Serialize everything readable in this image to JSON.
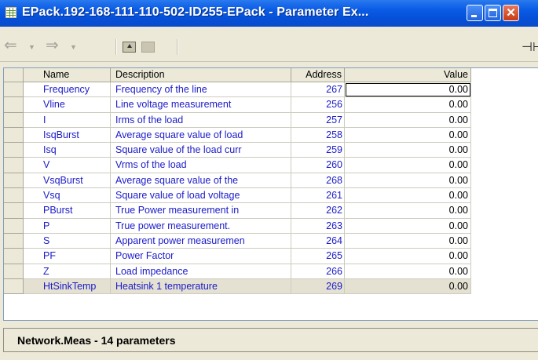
{
  "window": {
    "title": "EPack.192-168-111-110-502-ID255-EPack - Parameter Ex...",
    "app_icon": "table-icon",
    "close_glyph": "✕"
  },
  "toolbar": {
    "back_glyph": "⇐",
    "forward_glyph": "⇒",
    "dropdown_glyph": "▼",
    "pin_glyph": "⊣⊢"
  },
  "table": {
    "columns": [
      "Name",
      "Description",
      "Address",
      "Value"
    ],
    "rows": [
      {
        "name": "Frequency",
        "description": "Frequency of the line",
        "address": "267",
        "value": "0.00"
      },
      {
        "name": "Vline",
        "description": "Line voltage measurement",
        "address": "256",
        "value": "0.00"
      },
      {
        "name": "I",
        "description": "Irms of the load",
        "address": "257",
        "value": "0.00"
      },
      {
        "name": "IsqBurst",
        "description": "Average square value of load",
        "address": "258",
        "value": "0.00"
      },
      {
        "name": "Isq",
        "description": "Square value of the load curr",
        "address": "259",
        "value": "0.00"
      },
      {
        "name": "V",
        "description": "Vrms of the load",
        "address": "260",
        "value": "0.00"
      },
      {
        "name": "VsqBurst",
        "description": "Average square value of the",
        "address": "268",
        "value": "0.00"
      },
      {
        "name": "Vsq",
        "description": "Square value of load voltage",
        "address": "261",
        "value": "0.00"
      },
      {
        "name": "PBurst",
        "description": "True Power measurement in",
        "address": "262",
        "value": "0.00"
      },
      {
        "name": "P",
        "description": "True power measurement.",
        "address": "263",
        "value": "0.00"
      },
      {
        "name": "S",
        "description": "Apparent power measuremen",
        "address": "264",
        "value": "0.00"
      },
      {
        "name": "PF",
        "description": "Power Factor",
        "address": "265",
        "value": "0.00"
      },
      {
        "name": "Z",
        "description": "Load impedance",
        "address": "266",
        "value": "0.00"
      },
      {
        "name": "HtSinkTemp",
        "description": "Heatsink 1 temperature",
        "address": "269",
        "value": "0.00"
      }
    ]
  },
  "status": {
    "text": "Network.Meas  -  14 parameters"
  }
}
